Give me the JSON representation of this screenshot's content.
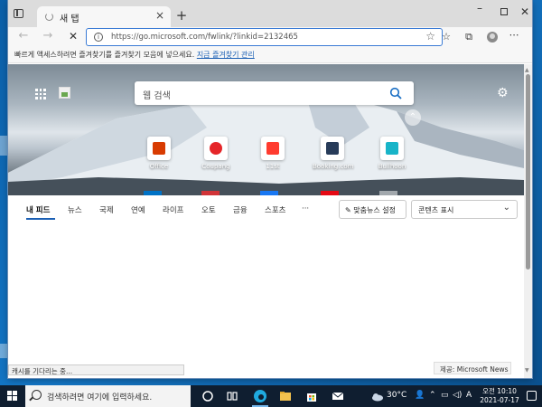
{
  "browser": {
    "tab_title": "새 탭",
    "tab_close": "×",
    "new_tab": "+",
    "window_controls": {
      "minimize": "–",
      "close": "✕"
    },
    "url": "https://go.microsoft.com/fwlink/?linkid=2132465",
    "nav": {
      "back": "←",
      "forward": "→",
      "stop": "✕"
    },
    "favorites_message": "빠르게 액세스하려면 즐겨찾기를 즐겨찾기 모음에 넣으세요. ",
    "favorites_link": "지금 즐겨찾기 관리",
    "more": "⋯"
  },
  "newtab": {
    "search_placeholder": "웹 검색",
    "tiles": [
      {
        "label": "Office",
        "color": "#d83b01"
      },
      {
        "label": "Coupang",
        "color": "#e52528"
      },
      {
        "label": "11st",
        "color": "#ff3b2f"
      },
      {
        "label": "Booking.com",
        "color": "#273b59"
      },
      {
        "label": "Bullhoon",
        "color": "#18b4c8"
      }
    ],
    "feed_tabs": [
      "내 피드",
      "뉴스",
      "국제",
      "연예",
      "라이프",
      "오토",
      "금융",
      "스포츠",
      "···"
    ],
    "personalize_button": "맞춤뉴스 설정",
    "content_select": "콘텐츠 표시",
    "status_text": "캐시를 기다리는 중...",
    "provider": "제공: Microsoft News"
  },
  "taskbar": {
    "search_placeholder": "검색하려면 여기에 입력하세요.",
    "weather": "30°C",
    "time": "오전 10:10",
    "date": "2021-07-17",
    "ime": "A"
  }
}
